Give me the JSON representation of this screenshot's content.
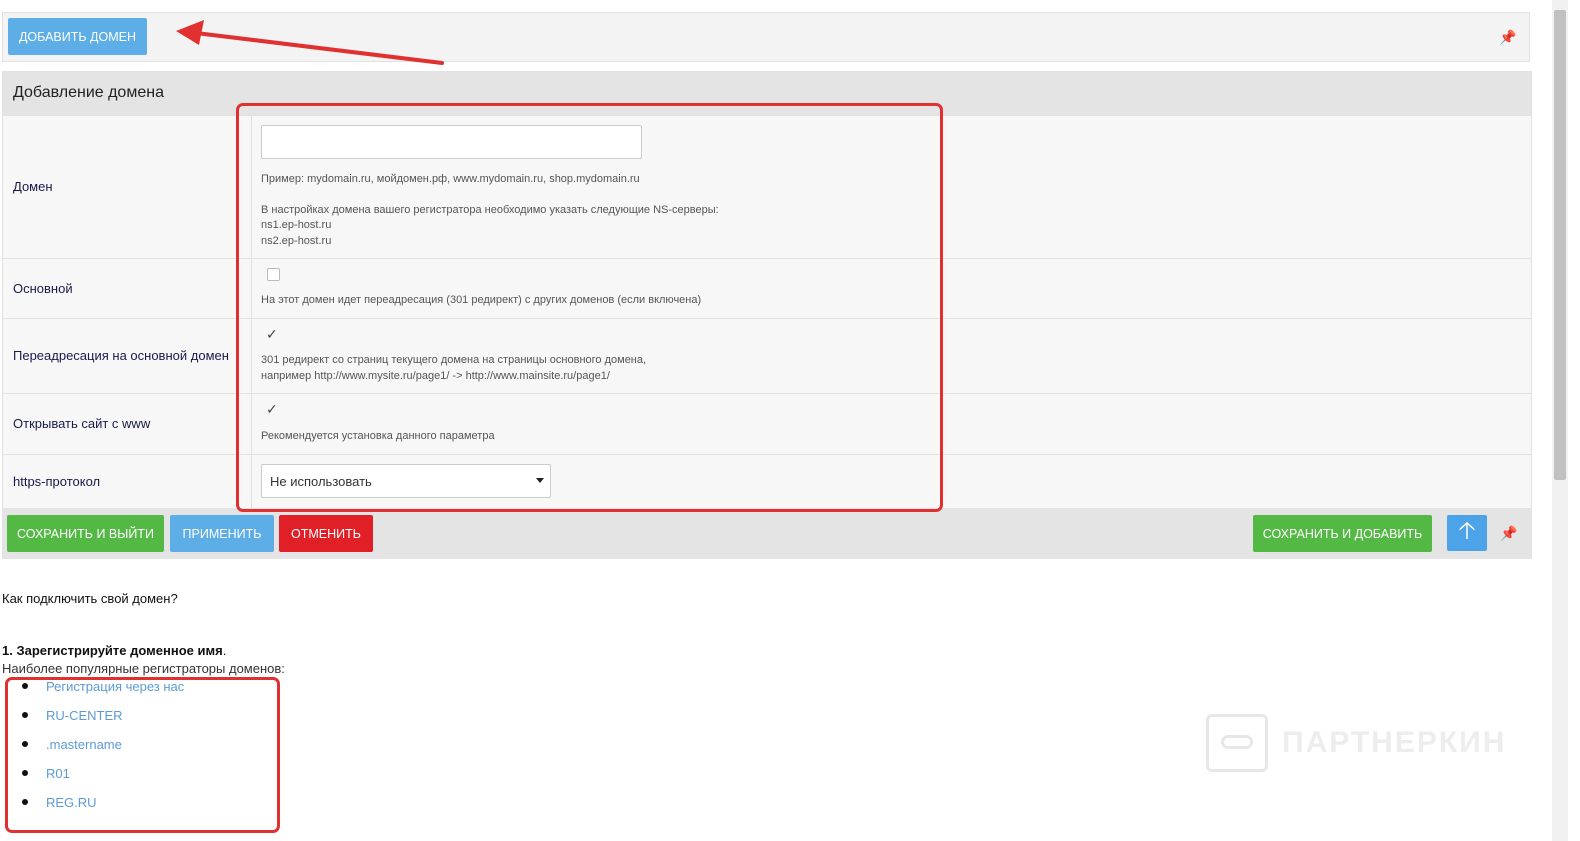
{
  "top_bar": {
    "add_domain_label": "ДОБАВИТЬ ДОМЕН"
  },
  "panel": {
    "title": "Добавление домена",
    "rows": {
      "domain": {
        "label": "Домен",
        "input_value": "",
        "hint_example": "Пример: mydomain.ru, мойдомен.рф, www.mydomain.ru, shop.mydomain.ru",
        "hint_ns": "В настройках домена вашего регистратора необходимо указать следующие NS-серверы:",
        "ns1": "ns1.ep-host.ru",
        "ns2": "ns2.ep-host.ru"
      },
      "main": {
        "label": "Основной",
        "checked": false,
        "hint": "На этот домен идет переадресация (301 редирект) с других доменов (если включена)"
      },
      "redirect": {
        "label": "Переадресация на основной домен",
        "checked": true,
        "check_glyph": "✓",
        "hint_line1": "301 редирект со страниц текущего домена на страницы основного домена,",
        "hint_line2": "например http://www.mysite.ru/page1/ -> http://www.mainsite.ru/page1/"
      },
      "www": {
        "label": "Открывать сайт с www",
        "checked": true,
        "check_glyph": "✓",
        "hint": "Рекомендуется установка данного параметра"
      },
      "https": {
        "label": "https-протокол",
        "selected": "Не использовать"
      }
    }
  },
  "actions": {
    "save_exit": "СОХРАНИТЬ И ВЫЙТИ",
    "apply": "ПРИМЕНИТЬ",
    "cancel": "ОТМЕНИТЬ",
    "save_add": "СОХРАНИТЬ И ДОБАВИТЬ",
    "up_glyph": "🡡"
  },
  "guide": {
    "question": "Как подключить свой домен?",
    "step1_bold": "1. Зарегистрируйте доменное имя",
    "step1_tail": ".",
    "registrars_intro": "Наиболее популярные регистраторы доменов:",
    "registrars": [
      {
        "label": "Регистрация через нас"
      },
      {
        "label": "RU-CENTER"
      },
      {
        "label": ".mastername"
      },
      {
        "label": "R01"
      },
      {
        "label": "REG.RU"
      }
    ]
  },
  "watermark": {
    "text": "ПАРТНЕРКИН"
  },
  "colors": {
    "annotation_red": "#e03030",
    "button_blue": "#5daee7",
    "button_green": "#54b845",
    "button_red": "#e01f26",
    "link_blue": "#5b9bd5"
  }
}
